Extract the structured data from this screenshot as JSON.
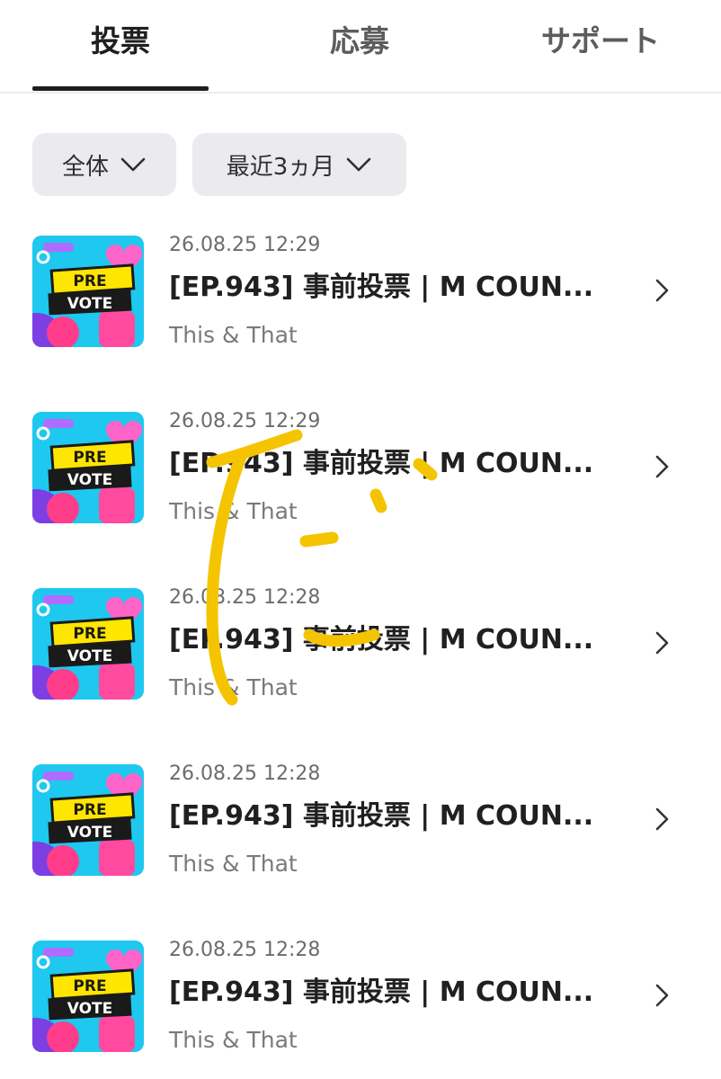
{
  "tabs": [
    {
      "label": "投票",
      "active": true
    },
    {
      "label": "応募",
      "active": false
    },
    {
      "label": "サポート",
      "active": false
    }
  ],
  "filters": {
    "scope": "全体",
    "period": "最近3ヵ月"
  },
  "list": [
    {
      "time": "26.08.25 12:29",
      "title": "[EP.943] 事前投票 | M COUN...",
      "subtitle": "This & That",
      "thumb": {
        "line1": "PRE",
        "line2": "VOTE"
      }
    },
    {
      "time": "26.08.25 12:29",
      "title": "[EP.943] 事前投票 | M COUN...",
      "subtitle": "This & That",
      "thumb": {
        "line1": "PRE",
        "line2": "VOTE"
      }
    },
    {
      "time": "26.08.25 12:28",
      "title": "[EP.943] 事前投票 | M COUN...",
      "subtitle": "This & That",
      "thumb": {
        "line1": "PRE",
        "line2": "VOTE"
      }
    },
    {
      "time": "26.08.25 12:28",
      "title": "[EP.943] 事前投票 | M COUN...",
      "subtitle": "This & That",
      "thumb": {
        "line1": "PRE",
        "line2": "VOTE"
      }
    },
    {
      "time": "26.08.25 12:28",
      "title": "[EP.943] 事前投票 | M COUN...",
      "subtitle": "This & That",
      "thumb": {
        "line1": "PRE",
        "line2": "VOTE"
      }
    }
  ],
  "icons": {
    "filter_dropdown": "chevron-down-icon",
    "row_arrow": "chevron-right-icon"
  },
  "colors": {
    "scribble": "#f5c400",
    "thumb_bg": "#1ec8ef",
    "thumb_banner": "#ffe600"
  }
}
